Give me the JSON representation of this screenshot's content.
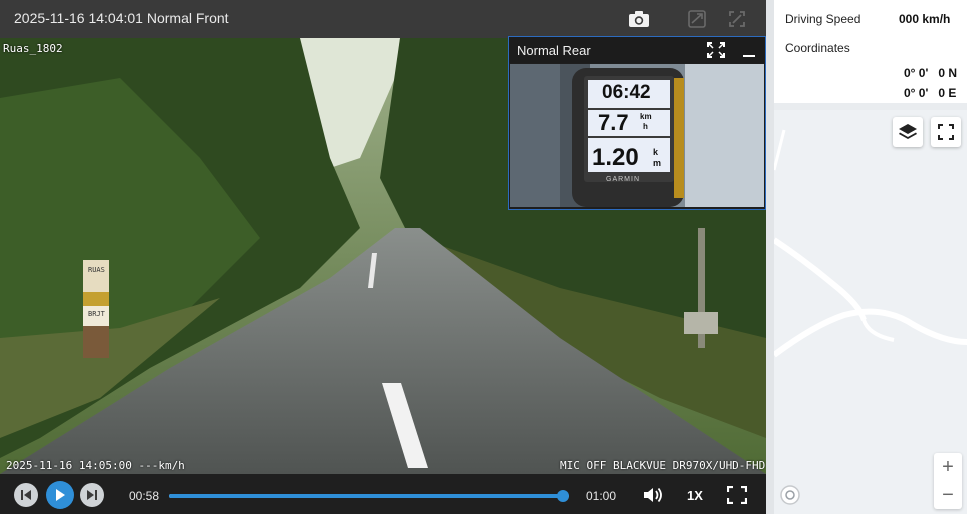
{
  "title_bar": {
    "title": "2025-11-16 14:04:01 Normal Front",
    "icons": [
      "camera-icon",
      "share-icon",
      "crop-icon"
    ]
  },
  "video": {
    "location_label": "Ruas_1802",
    "timestamp_overlay": "2025-11-16 14:05:00 ---km/h",
    "device_overlay": "MIC OFF BLACKVUE DR970X/UHD-FHD",
    "road_sign_top": "RUAS",
    "road_sign_bottom": "BRJT"
  },
  "rear_pip": {
    "title": "Normal Rear",
    "gps_screen": {
      "time": "06:42",
      "speed": "7.7",
      "speed_unit_top": "km",
      "speed_unit_bottom": "h",
      "distance": "1.20",
      "distance_unit_top": "k",
      "distance_unit_bottom": "m",
      "brand": "GARMIN"
    }
  },
  "controls": {
    "current_time": "00:58",
    "total_time": "01:00",
    "progress_fraction": 0.985,
    "playback_rate": "1X"
  },
  "info": {
    "speed_label": "Driving Speed",
    "speed_value": "000 km/h",
    "coords_label": "Coordinates",
    "lat_value": "0° 0'   0 N",
    "lon_value": "0° 0'   0 E"
  },
  "map": {
    "zoom_in": "+",
    "zoom_out": "−"
  },
  "colors": {
    "accent": "#2f8fd8",
    "title_bar": "#3a3a3a",
    "controls_bg": "#1f1f1f",
    "pip_border": "#2c6bbf"
  }
}
